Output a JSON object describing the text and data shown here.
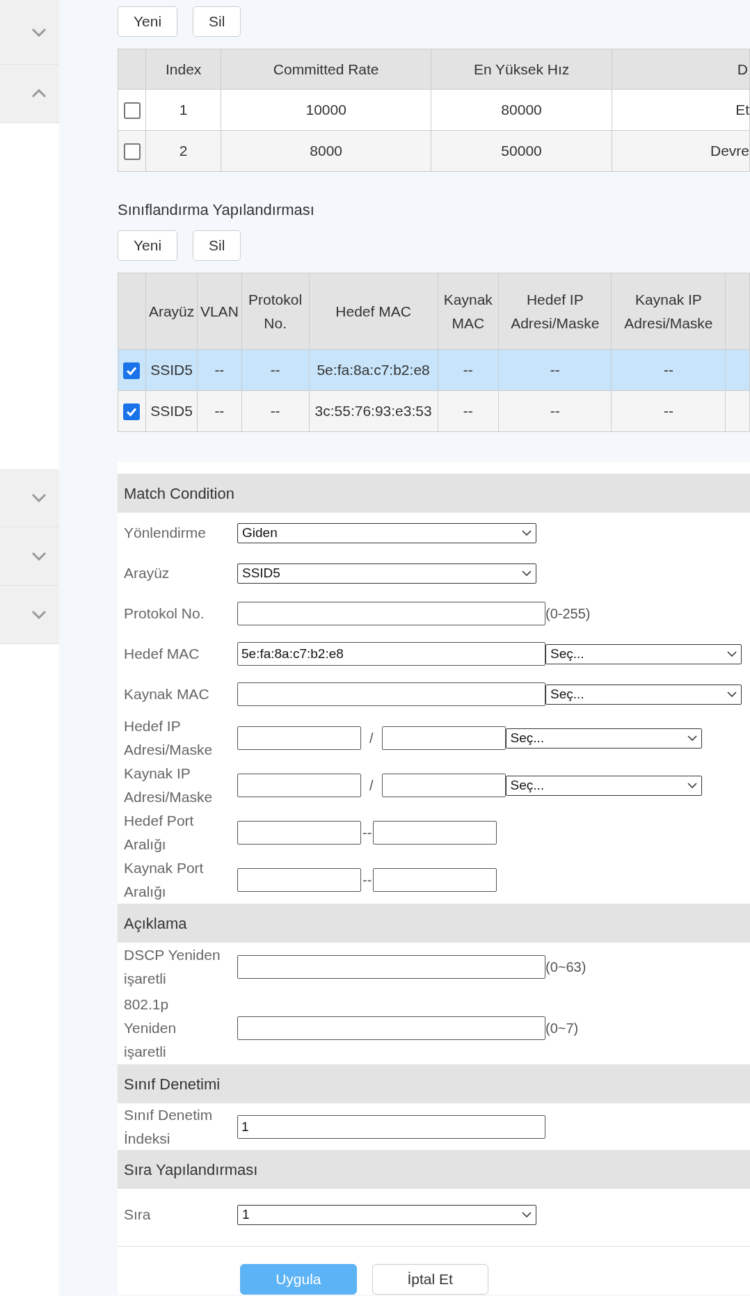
{
  "sidebar": {
    "top_items": [
      {
        "expanded": false
      },
      {
        "expanded": true
      }
    ],
    "bottom_items": [
      {
        "expanded": false
      },
      {
        "expanded": false
      },
      {
        "expanded": false
      }
    ]
  },
  "rate_table": {
    "buttons": [
      "Yeni",
      "Sil"
    ],
    "columns": [
      "Index",
      "Committed Rate",
      "En Yüksek Hız",
      "D"
    ],
    "rows": [
      {
        "checked": false,
        "selected": false,
        "cells": [
          "1",
          "10000",
          "80000",
          "Et"
        ]
      },
      {
        "checked": false,
        "selected": false,
        "cells": [
          "2",
          "8000",
          "50000",
          "Devre"
        ]
      }
    ]
  },
  "classification": {
    "title": "Sınıflandırma Yapılandırması",
    "buttons": [
      "Yeni",
      "Sil"
    ],
    "columns": [
      "Arayüz",
      "VLAN",
      "Protokol No.",
      "Hedef MAC",
      "Kaynak MAC",
      "Hedef IP Adresi/Maske",
      "Kaynak IP Adresi/Maske"
    ],
    "rows": [
      {
        "checked": true,
        "selected": true,
        "cells": [
          "SSID5",
          "--",
          "--",
          "5e:fa:8a:c7:b2:e8",
          "--",
          "--",
          "--"
        ]
      },
      {
        "checked": true,
        "selected": false,
        "cells": [
          "SSID5",
          "--",
          "--",
          "3c:55:76:93:e3:53",
          "--",
          "--",
          "--"
        ]
      }
    ]
  },
  "form_sections": [
    {
      "title": "Match Condition",
      "fields": [
        {
          "kind": "select",
          "label": "Yönlendirme",
          "value": "Giden"
        },
        {
          "kind": "select",
          "label": "Arayüz",
          "value": "SSID5"
        },
        {
          "kind": "text",
          "label": "Protokol No.",
          "hint": "(0-255)"
        },
        {
          "kind": "text_select",
          "label": "Hedef MAC",
          "value": "5e:fa:8a:c7:b2:e8",
          "select_value": "Seç..."
        },
        {
          "kind": "text_select",
          "label": "Kaynak MAC",
          "select_value": "Seç..."
        },
        {
          "kind": "ip",
          "label": "Hedef IP Adresi/Maske",
          "separator": "/",
          "select_value": "Seç..."
        },
        {
          "kind": "ip",
          "label": "Kaynak IP Adresi/Maske",
          "separator": "/",
          "select_value": "Seç..."
        },
        {
          "kind": "range",
          "label": "Hedef Port Aralığı",
          "separator": "--"
        },
        {
          "kind": "range",
          "label": "Kaynak Port Aralığı",
          "separator": "--"
        }
      ]
    },
    {
      "title": "Açıklama",
      "fields": [
        {
          "kind": "text",
          "label": "DSCP Yeniden işaretli",
          "hint": "(0~63)"
        },
        {
          "kind": "text",
          "label": "802.1p Yeniden işaretli",
          "hint": "(0~7)"
        }
      ]
    },
    {
      "title": "Sınıf Denetimi",
      "fields": [
        {
          "kind": "text",
          "label": "Sınıf Denetim İndeksi",
          "value": "1"
        }
      ]
    },
    {
      "title": "Sıra Yapılandırması",
      "fields": [
        {
          "kind": "select",
          "label": "Sıra",
          "value": "1"
        }
      ]
    }
  ],
  "footer_buttons": [
    {
      "kind": "primary",
      "label": "Uygula"
    },
    {
      "kind": "secondary",
      "label": "İptal Et"
    }
  ]
}
